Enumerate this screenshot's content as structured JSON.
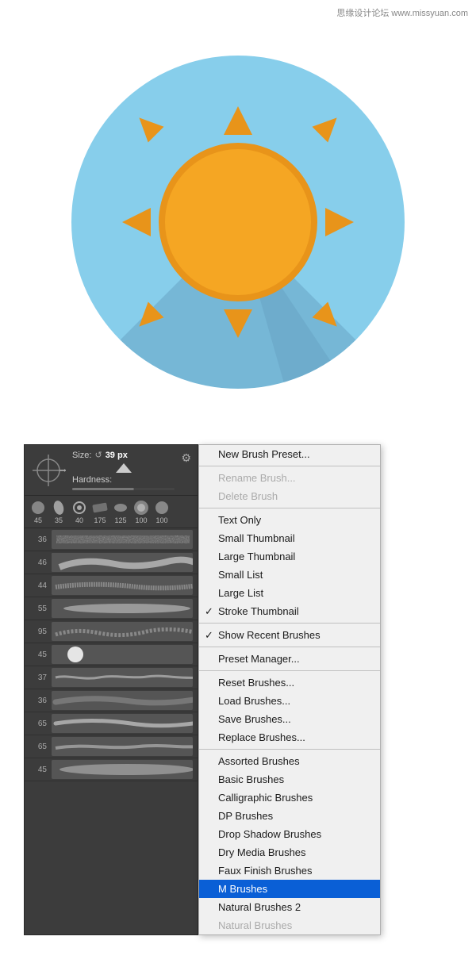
{
  "watermark": {
    "text": "思缘设计论坛 www.missyuan.com"
  },
  "sun": {
    "aria_label": "Flat sun icon with long shadow"
  },
  "ps_panel": {
    "size_label": "Size:",
    "size_icon": "↺",
    "size_value": "39 px",
    "hardness_label": "Hardness:",
    "brush_tips": [
      {
        "size": "45"
      },
      {
        "size": "35"
      },
      {
        "size": "40"
      },
      {
        "size": "175"
      },
      {
        "size": "125"
      },
      {
        "size": "100"
      },
      {
        "size": "100"
      }
    ],
    "brush_items": [
      {
        "num": "36",
        "type": "scattered"
      },
      {
        "num": "46",
        "type": "fluffy"
      },
      {
        "num": "44",
        "type": "textured"
      },
      {
        "num": "55",
        "type": "soft"
      },
      {
        "num": "95",
        "type": "rough"
      },
      {
        "num": "45",
        "type": "round"
      },
      {
        "num": "37",
        "type": "mixed"
      },
      {
        "num": "36",
        "type": "scattered2"
      },
      {
        "num": "65",
        "type": "stroke"
      },
      {
        "num": "65",
        "type": "stroke2"
      },
      {
        "num": "45",
        "type": "soft2"
      }
    ]
  },
  "context_menu": {
    "items": [
      {
        "id": "new-brush-preset",
        "label": "New Brush Preset...",
        "disabled": false,
        "checked": false,
        "highlighted": false,
        "separator_after": false
      },
      {
        "id": "separator-1",
        "type": "separator"
      },
      {
        "id": "rename-brush",
        "label": "Rename Brush...",
        "disabled": true,
        "checked": false,
        "highlighted": false,
        "separator_after": false
      },
      {
        "id": "delete-brush",
        "label": "Delete Brush",
        "disabled": true,
        "checked": false,
        "highlighted": false,
        "separator_after": true
      },
      {
        "id": "separator-2",
        "type": "separator"
      },
      {
        "id": "text-only",
        "label": "Text Only",
        "disabled": false,
        "checked": false,
        "highlighted": false,
        "separator_after": false
      },
      {
        "id": "small-thumbnail",
        "label": "Small Thumbnail",
        "disabled": false,
        "checked": false,
        "highlighted": false,
        "separator_after": false
      },
      {
        "id": "large-thumbnail",
        "label": "Large Thumbnail",
        "disabled": false,
        "checked": false,
        "highlighted": false,
        "separator_after": false
      },
      {
        "id": "small-list",
        "label": "Small List",
        "disabled": false,
        "checked": false,
        "highlighted": false,
        "separator_after": false
      },
      {
        "id": "large-list",
        "label": "Large List",
        "disabled": false,
        "checked": false,
        "highlighted": false,
        "separator_after": false
      },
      {
        "id": "stroke-thumbnail",
        "label": "Stroke Thumbnail",
        "disabled": false,
        "checked": true,
        "highlighted": false,
        "separator_after": false
      },
      {
        "id": "separator-3",
        "type": "separator"
      },
      {
        "id": "show-recent-brushes",
        "label": "Show Recent Brushes",
        "disabled": false,
        "checked": true,
        "highlighted": false,
        "separator_after": false
      },
      {
        "id": "separator-4",
        "type": "separator"
      },
      {
        "id": "preset-manager",
        "label": "Preset Manager...",
        "disabled": false,
        "checked": false,
        "highlighted": false,
        "separator_after": false
      },
      {
        "id": "separator-5",
        "type": "separator"
      },
      {
        "id": "reset-brushes",
        "label": "Reset Brushes...",
        "disabled": false,
        "checked": false,
        "highlighted": false,
        "separator_after": false
      },
      {
        "id": "load-brushes",
        "label": "Load Brushes...",
        "disabled": false,
        "checked": false,
        "highlighted": false,
        "separator_after": false
      },
      {
        "id": "save-brushes",
        "label": "Save Brushes...",
        "disabled": false,
        "checked": false,
        "highlighted": false,
        "separator_after": false
      },
      {
        "id": "replace-brushes",
        "label": "Replace Brushes...",
        "disabled": false,
        "checked": false,
        "highlighted": false,
        "separator_after": false
      },
      {
        "id": "separator-6",
        "type": "separator"
      },
      {
        "id": "assorted-brushes",
        "label": "Assorted Brushes",
        "disabled": false,
        "checked": false,
        "highlighted": false,
        "separator_after": false
      },
      {
        "id": "basic-brushes",
        "label": "Basic Brushes",
        "disabled": false,
        "checked": false,
        "highlighted": false,
        "separator_after": false
      },
      {
        "id": "calligraphic-brushes",
        "label": "Calligraphic Brushes",
        "disabled": false,
        "checked": false,
        "highlighted": false,
        "separator_after": false
      },
      {
        "id": "dp-brushes",
        "label": "DP Brushes",
        "disabled": false,
        "checked": false,
        "highlighted": false,
        "separator_after": false
      },
      {
        "id": "drop-shadow-brushes",
        "label": "Drop Shadow Brushes",
        "disabled": false,
        "checked": false,
        "highlighted": false,
        "separator_after": false
      },
      {
        "id": "dry-media-brushes",
        "label": "Dry Media Brushes",
        "disabled": false,
        "checked": false,
        "highlighted": false,
        "separator_after": false
      },
      {
        "id": "faux-finish-brushes",
        "label": "Faux Finish Brushes",
        "disabled": false,
        "checked": false,
        "highlighted": false,
        "separator_after": false
      },
      {
        "id": "m-brushes",
        "label": "M Brushes",
        "disabled": false,
        "checked": false,
        "highlighted": true,
        "separator_after": false
      },
      {
        "id": "natural-brushes-2",
        "label": "Natural Brushes 2",
        "disabled": false,
        "checked": false,
        "highlighted": false,
        "separator_after": false
      },
      {
        "id": "natural-brushes",
        "label": "Natural Brushes",
        "disabled": true,
        "checked": false,
        "highlighted": false,
        "separator_after": false
      }
    ]
  }
}
